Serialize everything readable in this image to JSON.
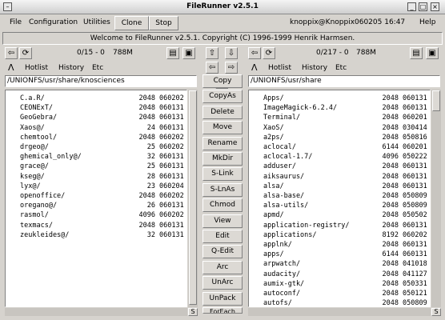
{
  "window": {
    "title": "FileRunner v2.5.1"
  },
  "menubar": {
    "file": "File",
    "configuration": "Configuration",
    "utilities": "Utilities",
    "clone": "Clone",
    "stop": "Stop",
    "host": "knoppix@Knoppix",
    "clock": "060205 16:47",
    "help": "Help"
  },
  "welcome": "Welcome to FileRunner v2.5.1. Copyright (C) 1996-1999 Henrik Harmsen.",
  "left": {
    "stats": "0/15 - 0",
    "size": "788M",
    "hotlist": "Hotlist",
    "history": "History",
    "etc": "Etc",
    "path": "/UNIONFS/usr/share/knosciences",
    "files": [
      {
        "name": "C.a.R/",
        "size": "2048",
        "date": "060202"
      },
      {
        "name": "CEONExT/",
        "size": "2048",
        "date": "060131"
      },
      {
        "name": "GeoGebra/",
        "size": "2048",
        "date": "060131"
      },
      {
        "name": "Xaos@/",
        "size": "24",
        "date": "060131"
      },
      {
        "name": "chemtool/",
        "size": "2048",
        "date": "060202"
      },
      {
        "name": "drgeo@/",
        "size": "25",
        "date": "060202"
      },
      {
        "name": "ghemical_only@/",
        "size": "32",
        "date": "060131"
      },
      {
        "name": "grace@/",
        "size": "25",
        "date": "060131"
      },
      {
        "name": "kseg@/",
        "size": "28",
        "date": "060131"
      },
      {
        "name": "lyx@/",
        "size": "23",
        "date": "060204"
      },
      {
        "name": "openoffice/",
        "size": "2048",
        "date": "060202"
      },
      {
        "name": "oregano@/",
        "size": "26",
        "date": "060131"
      },
      {
        "name": "rasmol/",
        "size": "4096",
        "date": "060202"
      },
      {
        "name": "texmacs/",
        "size": "2048",
        "date": "060131"
      },
      {
        "name": "zeukleides@/",
        "size": "32",
        "date": "060131"
      }
    ]
  },
  "right": {
    "stats": "0/217 - 0",
    "size": "788M",
    "hotlist": "Hotlist",
    "history": "History",
    "etc": "Etc",
    "path": "/UNIONFS/usr/share",
    "files": [
      {
        "name": "Apps/",
        "size": "2048",
        "date": "060131"
      },
      {
        "name": "ImageMagick-6.2.4/",
        "size": "2048",
        "date": "060131"
      },
      {
        "name": "Terminal/",
        "size": "2048",
        "date": "060201"
      },
      {
        "name": "XaoS/",
        "size": "2048",
        "date": "030414"
      },
      {
        "name": "a2ps/",
        "size": "2048",
        "date": "050816"
      },
      {
        "name": "aclocal/",
        "size": "6144",
        "date": "060201"
      },
      {
        "name": "aclocal-1.7/",
        "size": "4096",
        "date": "050222"
      },
      {
        "name": "adduser/",
        "size": "2048",
        "date": "060131"
      },
      {
        "name": "aiksaurus/",
        "size": "2048",
        "date": "060131"
      },
      {
        "name": "alsa/",
        "size": "2048",
        "date": "060131"
      },
      {
        "name": "alsa-base/",
        "size": "2048",
        "date": "050809"
      },
      {
        "name": "alsa-utils/",
        "size": "2048",
        "date": "050809"
      },
      {
        "name": "apmd/",
        "size": "2048",
        "date": "050502"
      },
      {
        "name": "application-registry/",
        "size": "2048",
        "date": "060131"
      },
      {
        "name": "applications/",
        "size": "8192",
        "date": "060202"
      },
      {
        "name": "applnk/",
        "size": "2048",
        "date": "060131"
      },
      {
        "name": "apps/",
        "size": "6144",
        "date": "060131"
      },
      {
        "name": "arpwatch/",
        "size": "2048",
        "date": "041018"
      },
      {
        "name": "audacity/",
        "size": "2048",
        "date": "041127"
      },
      {
        "name": "aumix-gtk/",
        "size": "2048",
        "date": "050331"
      },
      {
        "name": "autoconf/",
        "size": "2048",
        "date": "050121"
      },
      {
        "name": "autofs/",
        "size": "2048",
        "date": "050809"
      }
    ]
  },
  "actions": [
    "Copy",
    "CopyAs",
    "Delete",
    "Move",
    "Rename",
    "MkDir",
    "S-Link",
    "S-LnAs",
    "Chmod",
    "View",
    "Edit",
    "Q-Edit",
    "Arc",
    "UnArc",
    "UnPack",
    "ForEach"
  ]
}
